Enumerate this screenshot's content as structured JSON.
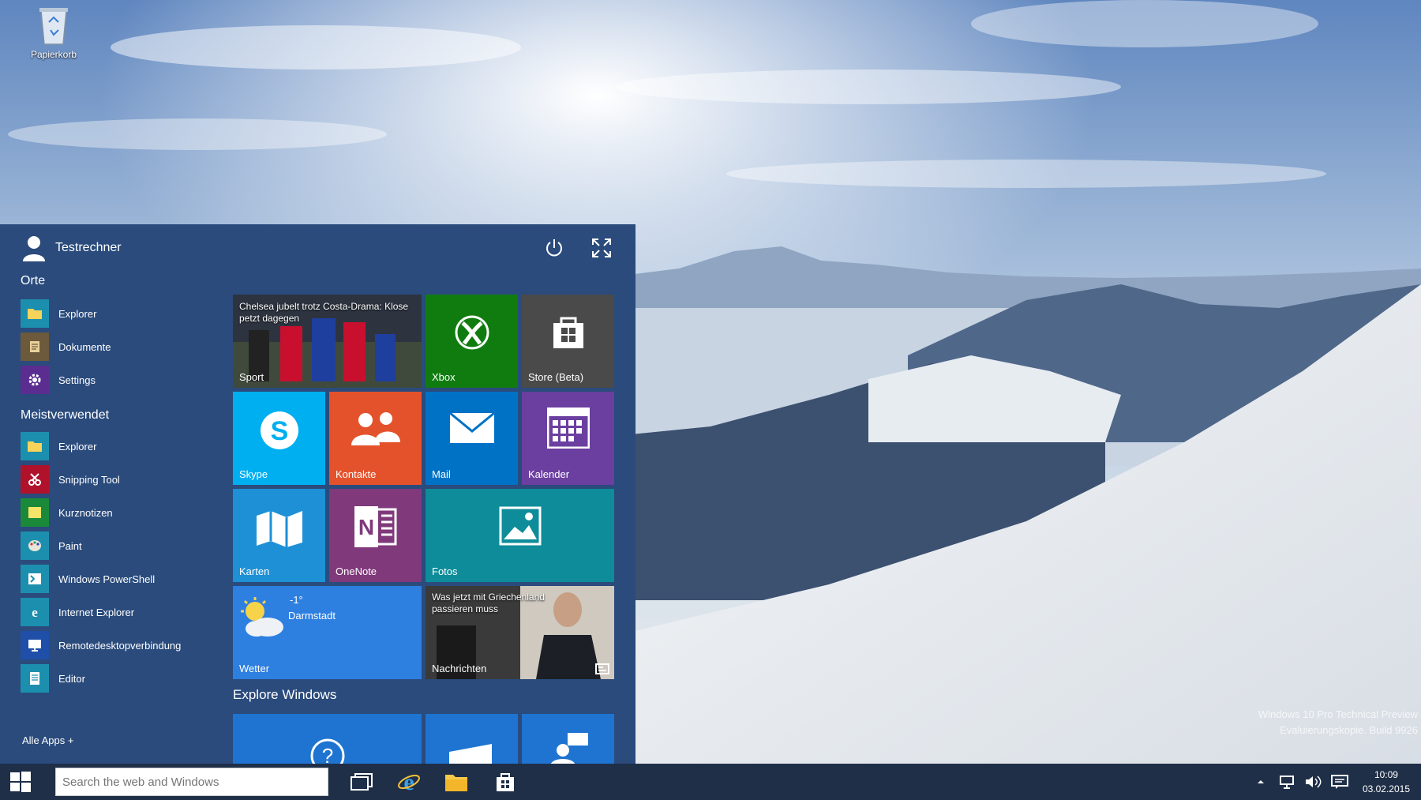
{
  "desktop": {
    "recycle_bin_label": "Papierkorb",
    "watermark_line1": "Windows 10 Pro Technical Preview",
    "watermark_line2": "Evaluierungskopie. Build 9926"
  },
  "start_menu": {
    "user_name": "Testrechner",
    "places_heading": "Orte",
    "places": [
      {
        "label": "Explorer",
        "icon": "folder-icon",
        "color": "#1d8fae"
      },
      {
        "label": "Dokumente",
        "icon": "documents-icon",
        "color": "#6d5a3c"
      },
      {
        "label": "Settings",
        "icon": "gear-icon",
        "color": "#5b2d90"
      }
    ],
    "most_used_heading": "Meistverwendet",
    "most_used": [
      {
        "label": "Explorer",
        "icon": "folder-icon",
        "color": "#1d8fae"
      },
      {
        "label": "Snipping Tool",
        "icon": "scissors-icon",
        "color": "#b0122b"
      },
      {
        "label": "Kurznotizen",
        "icon": "sticky-note-icon",
        "color": "#1a8a3a"
      },
      {
        "label": "Paint",
        "icon": "palette-icon",
        "color": "#1d8fae"
      },
      {
        "label": "Windows PowerShell",
        "icon": "powershell-icon",
        "color": "#1d8fae"
      },
      {
        "label": "Internet Explorer",
        "icon": "ie-icon",
        "color": "#1d8fae"
      },
      {
        "label": "Remotedesktopverbindung",
        "icon": "remote-desktop-icon",
        "color": "#1f4fa8"
      },
      {
        "label": "Editor",
        "icon": "notepad-icon",
        "color": "#1d8fae"
      }
    ],
    "all_apps_label": "Alle Apps +",
    "tiles": {
      "sport": {
        "label": "Sport",
        "headline": "Chelsea jubelt trotz Costa-Drama: Klose petzt dagegen"
      },
      "xbox": {
        "label": "Xbox",
        "color": "#107c10"
      },
      "store": {
        "label": "Store (Beta)",
        "color": "#4a4a4a"
      },
      "skype": {
        "label": "Skype",
        "color": "#00aff0"
      },
      "kontakte": {
        "label": "Kontakte",
        "color": "#e4522c"
      },
      "mail": {
        "label": "Mail",
        "color": "#0072c6"
      },
      "kalender": {
        "label": "Kalender",
        "color": "#6b3fa0"
      },
      "karten": {
        "label": "Karten",
        "color": "#1e90d6"
      },
      "onenote": {
        "label": "OneNote",
        "color": "#80397b"
      },
      "fotos": {
        "label": "Fotos",
        "color": "#0e8c99"
      },
      "wetter": {
        "label": "Wetter",
        "temp": "-1°",
        "city": "Darmstadt",
        "color": "#2d7fe0"
      },
      "nachrichten": {
        "label": "Nachrichten",
        "headline": "Was jetzt mit Griechenland passieren muss"
      }
    },
    "explore_heading": "Explore Windows"
  },
  "taskbar": {
    "search_placeholder": "Search the web and Windows",
    "clock_time": "10:09",
    "clock_date": "03.02.2015"
  }
}
